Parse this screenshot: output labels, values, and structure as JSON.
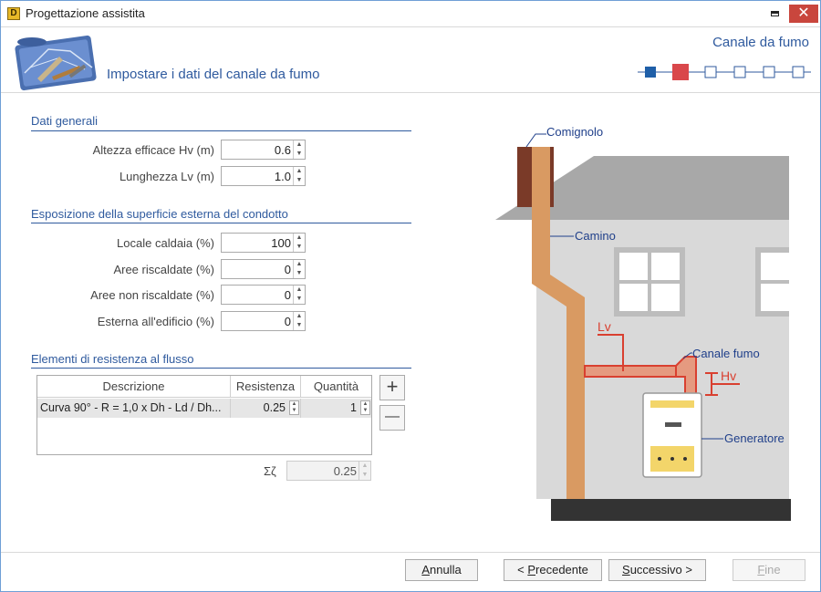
{
  "window": {
    "title": "Progettazione assistita",
    "app_icon_text": "D",
    "close_glyph": "✕"
  },
  "header": {
    "title": "Impostare i dati del canale da fumo",
    "section": "Canale da fumo"
  },
  "general": {
    "title": "Dati generali",
    "fields": [
      {
        "label": "Altezza efficace Hv (m)",
        "value": "0.6"
      },
      {
        "label": "Lunghezza Lv (m)",
        "value": "1.0"
      }
    ]
  },
  "exposure": {
    "title": "Esposizione della superficie esterna del condotto",
    "fields": [
      {
        "label": "Locale caldaia (%)",
        "value": "100"
      },
      {
        "label": "Aree riscaldate (%)",
        "value": "0"
      },
      {
        "label": "Aree non riscaldate (%)",
        "value": "0"
      },
      {
        "label": "Esterna all'edificio (%)",
        "value": "0"
      }
    ]
  },
  "resistance": {
    "title": "Elementi di resistenza al flusso",
    "columns": [
      "Descrizione",
      "Resistenza",
      "Quantità"
    ],
    "rows": [
      {
        "descrizione": "Curva 90° - R = 1,0 x Dh - Ld / Dh...",
        "resistenza": "0.25",
        "quantita": "1"
      }
    ],
    "add_glyph": "+",
    "remove_glyph": "—",
    "sum_label": "Σζ",
    "sum_value": "0.25"
  },
  "buttons": {
    "cancel": {
      "hotkey": "A",
      "rest": "nnulla"
    },
    "prev": {
      "pre": "< ",
      "hotkey": "P",
      "rest": "recedente"
    },
    "next": {
      "hotkey": "S",
      "rest": "uccessivo >"
    },
    "finish": {
      "hotkey": "F",
      "rest": "ine"
    }
  },
  "illustration": {
    "labels": {
      "comignolo": "Comignolo",
      "camino": "Camino",
      "lv": "Lv",
      "canale": "Canale fumo",
      "hv": "Hv",
      "generatore": "Generatore"
    }
  },
  "colors": {
    "accent": "#2f5a9e",
    "step_done": "#1f5fa8",
    "step_current": "#d9474b",
    "close": "#c9463d",
    "pipe": "#d99a62",
    "flue": "#d94030",
    "chimney_cap": "#7a3a28"
  },
  "steps": {
    "count": 6,
    "current": 2
  }
}
